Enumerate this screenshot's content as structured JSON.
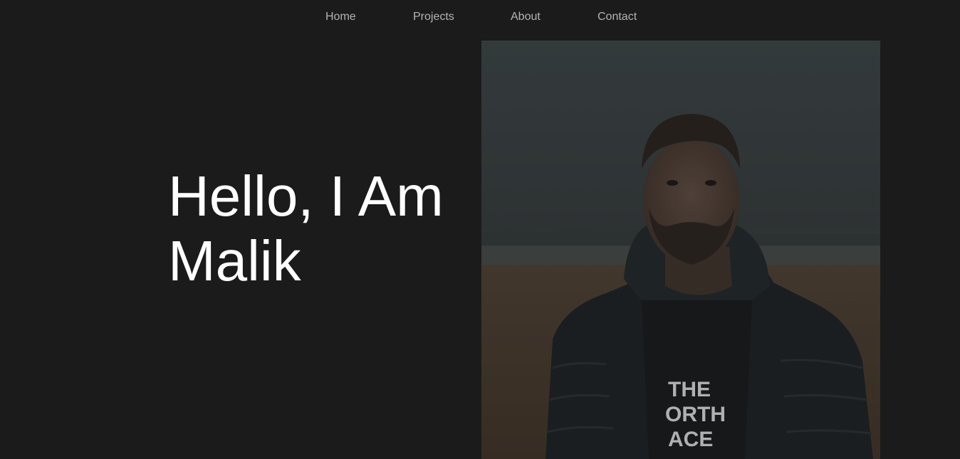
{
  "nav": {
    "items": [
      {
        "label": "Home"
      },
      {
        "label": "Projects"
      },
      {
        "label": "About"
      },
      {
        "label": "Contact"
      }
    ]
  },
  "hero": {
    "title_line1": "Hello, I Am",
    "title_line2": "Malik"
  },
  "photo": {
    "shirt_text": [
      "THE",
      "ORTH",
      "ACE"
    ]
  },
  "colors": {
    "background": "#1b1b1b",
    "nav_text": "#b4b4b4",
    "title_text": "#ffffff"
  }
}
